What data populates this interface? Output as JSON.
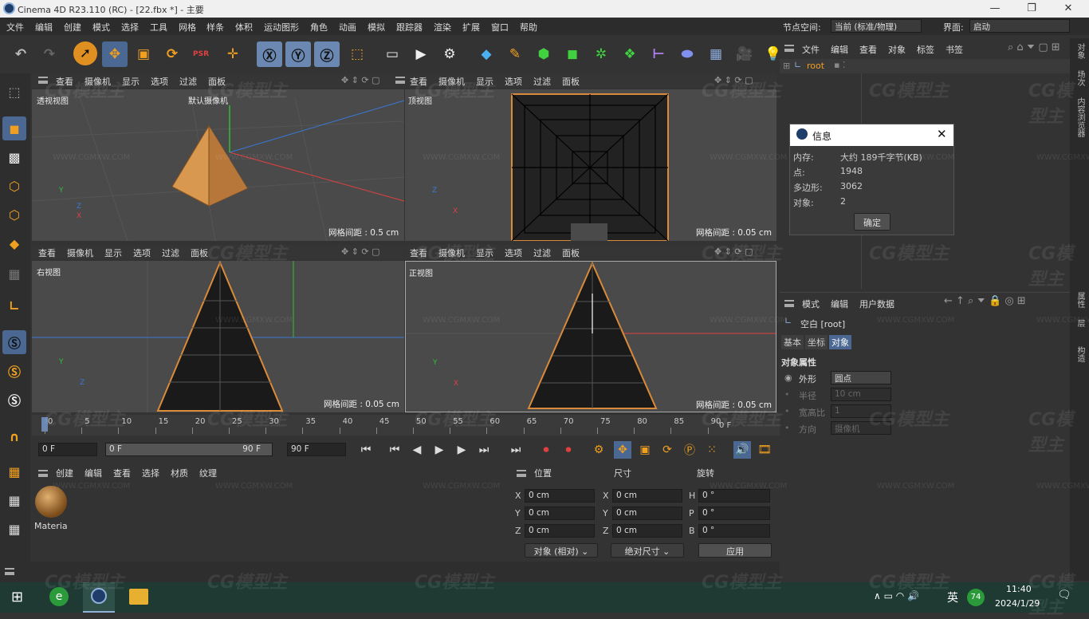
{
  "window": {
    "title": "Cinema 4D R23.110 (RC) - [22.fbx *] - 主要"
  },
  "menu": [
    "文件",
    "编辑",
    "创建",
    "模式",
    "选择",
    "工具",
    "网格",
    "样条",
    "体积",
    "运动图形",
    "角色",
    "动画",
    "模拟",
    "跟踪器",
    "渲染",
    "扩展",
    "窗口",
    "帮助"
  ],
  "node_space": {
    "label": "节点空间:",
    "value": "当前 (标准/物理)"
  },
  "interface": {
    "label": "界面:",
    "value": "启动"
  },
  "viewport_menu": [
    "查看",
    "摄像机",
    "显示",
    "选项",
    "过滤",
    "面板"
  ],
  "viewports": {
    "perspective": {
      "name": "透视视图",
      "camera": "默认摄像机",
      "grid": "网格间距 : 0.5 cm"
    },
    "top": {
      "name": "顶视图",
      "grid": "网格间距 : 0.05 cm"
    },
    "right": {
      "name": "右视图",
      "grid": "网格间距 : 0.05 cm"
    },
    "front": {
      "name": "正视图",
      "grid": "网格间距 : 0.05 cm"
    }
  },
  "axes": {
    "x": "X",
    "y": "Y",
    "z": "Z"
  },
  "timeline": {
    "ticks": [
      "0",
      "5",
      "10",
      "15",
      "20",
      "25",
      "30",
      "35",
      "40",
      "45",
      "50",
      "55",
      "60",
      "65",
      "70",
      "75",
      "80",
      "85",
      "90"
    ],
    "current": "0 F",
    "start": "0 F",
    "range_start": "0 F",
    "range_end": "90 F",
    "end": "90 F"
  },
  "material_panel": {
    "menu": [
      "创建",
      "编辑",
      "查看",
      "选择",
      "材质",
      "纹理"
    ],
    "material_name": "Materia"
  },
  "coords": {
    "headers": [
      "位置",
      "尺寸",
      "旋转"
    ],
    "rows": [
      {
        "pl": "X",
        "pv": "0 cm",
        "sl": "X",
        "sv": "0 cm",
        "rl": "H",
        "rv": "0 °"
      },
      {
        "pl": "Y",
        "pv": "0 cm",
        "sl": "Y",
        "sv": "0 cm",
        "rl": "P",
        "rv": "0 °"
      },
      {
        "pl": "Z",
        "pv": "0 cm",
        "sl": "Z",
        "sv": "0 cm",
        "rl": "B",
        "rv": "0 °"
      }
    ],
    "mode": "对象 (相对)",
    "size_mode": "绝对尺寸",
    "apply": "应用"
  },
  "object_manager": {
    "menu": [
      "文件",
      "编辑",
      "查看",
      "对象",
      "标签",
      "书签"
    ],
    "root": "root"
  },
  "info_dialog": {
    "title": "信息",
    "rows": [
      {
        "k": "内存:",
        "v": "大约 189千字节(KB)"
      },
      {
        "k": "点:",
        "v": "1948"
      },
      {
        "k": "多边形:",
        "v": "3062"
      },
      {
        "k": "对象:",
        "v": "2"
      }
    ],
    "ok": "确定"
  },
  "attributes": {
    "menu": [
      "模式",
      "编辑",
      "用户数据"
    ],
    "object": "空白 [root]",
    "tabs": [
      "基本",
      "坐标",
      "对象"
    ],
    "section": "对象属性",
    "props": [
      {
        "k": "外形",
        "v": "圆点"
      },
      {
        "k": "半径",
        "v": "10 cm"
      },
      {
        "k": "宽高比",
        "v": "1"
      },
      {
        "k": "方向",
        "v": "摄像机"
      }
    ]
  },
  "right_tabs": [
    "对象",
    "场次",
    "内容浏览器",
    "属性",
    "层",
    "构造"
  ],
  "taskbar": {
    "time": "11:40",
    "date": "2024/1/29",
    "ime": "英",
    "badge": "74"
  },
  "watermark": {
    "text": "CG模型主",
    "url": "WWW.CGMXW.COM"
  },
  "colors": {
    "accent": "#4a6891",
    "axis_x": "#e04040",
    "axis_y": "#30c030",
    "axis_z": "#3a78d8",
    "pyramid_wire": "#111111",
    "pyramid_outline": "#d98a3a"
  }
}
